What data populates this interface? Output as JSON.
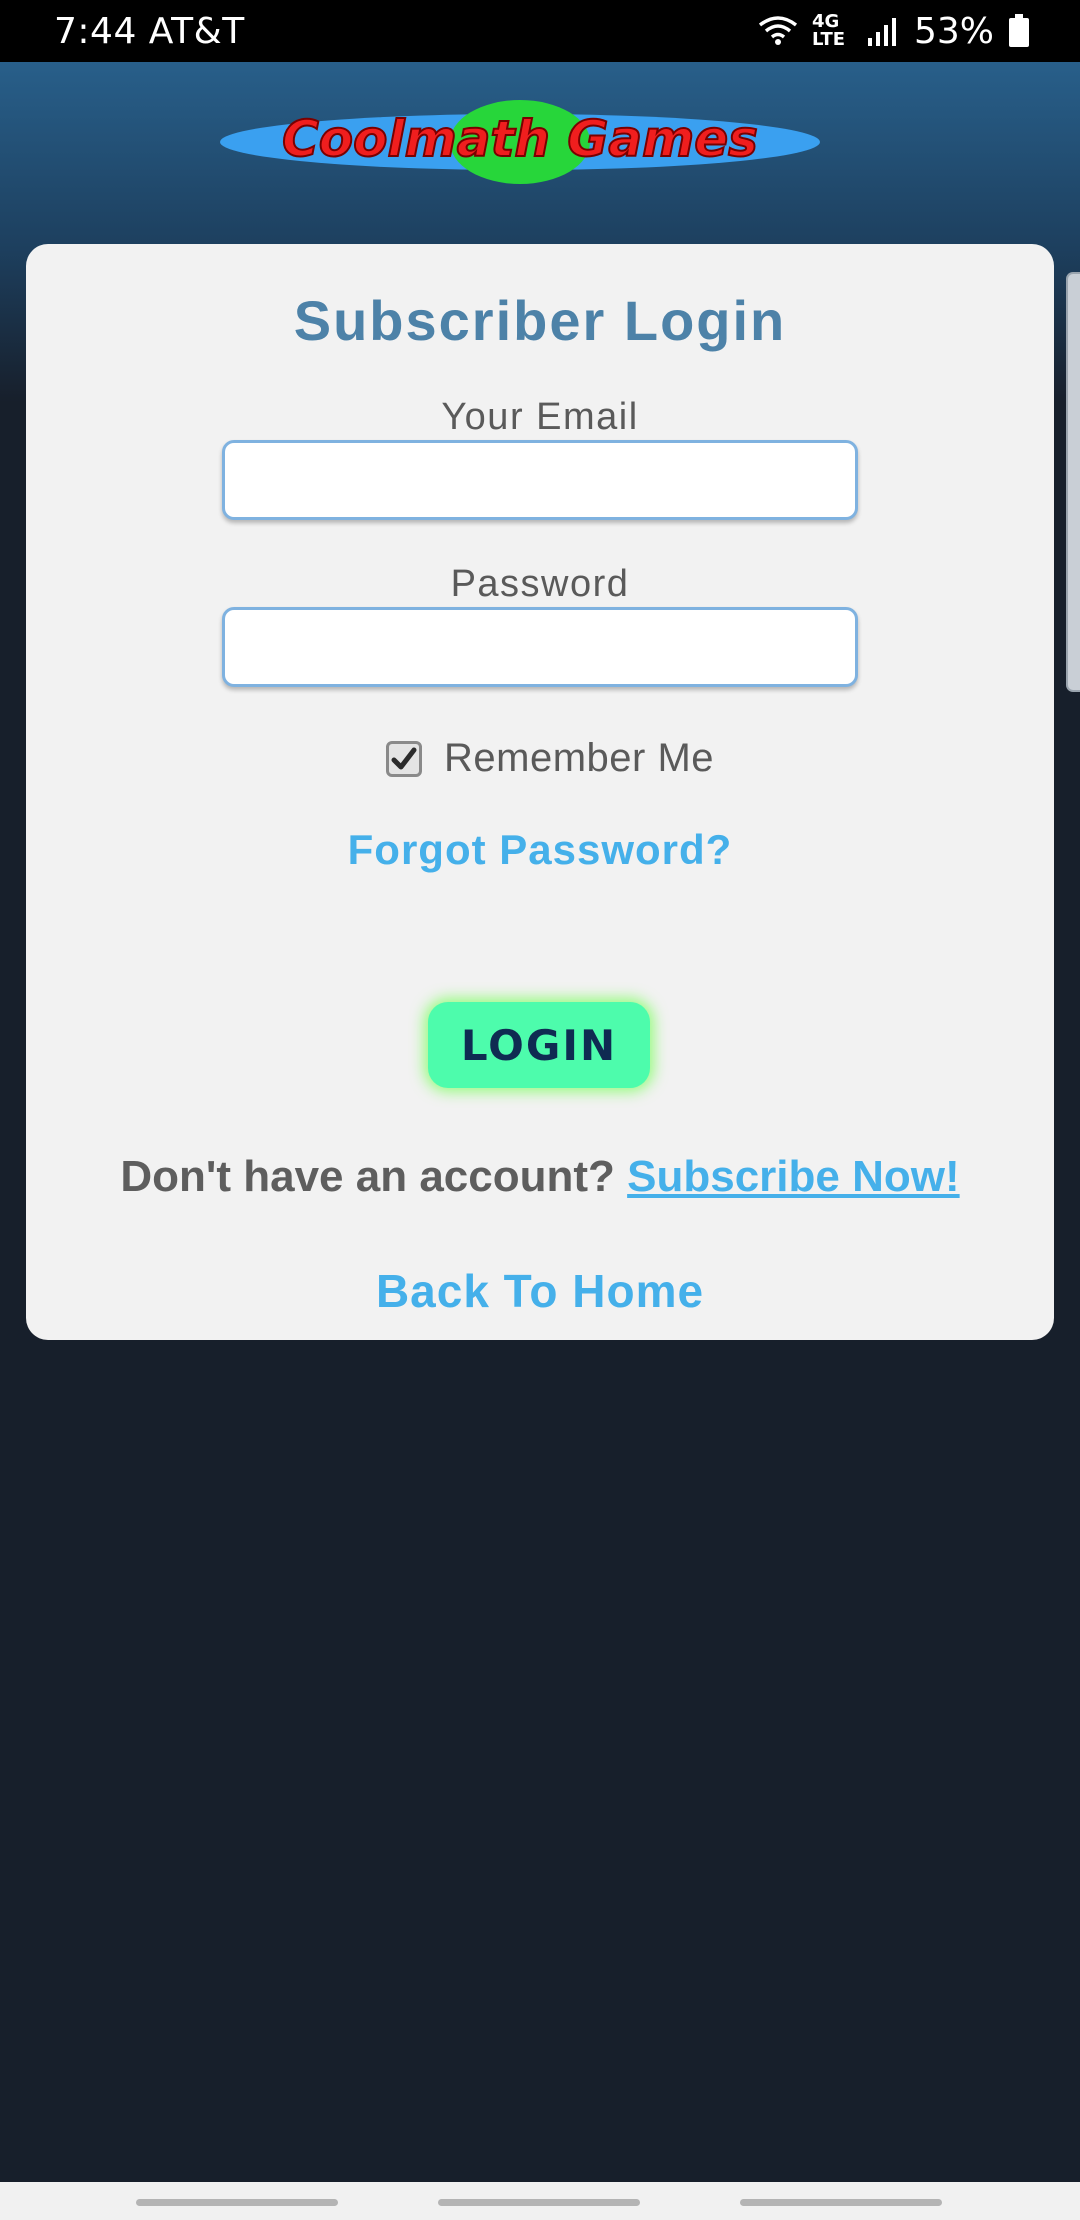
{
  "status_bar": {
    "time": "7:44",
    "carrier": "AT&T",
    "network": "4G LTE",
    "battery": "53%"
  },
  "logo": {
    "text": "Coolmath Games"
  },
  "login_form": {
    "title": "Subscriber Login",
    "email_label": "Your Email",
    "email_value": "",
    "password_label": "Password",
    "password_value": "",
    "remember_label": "Remember Me",
    "remember_checked": true,
    "forgot_password": "Forgot Password?",
    "login_button": "LOGIN",
    "no_account_text": "Don't have an account?",
    "subscribe_link": "Subscribe Now!",
    "back_home": "Back To Home"
  },
  "colors": {
    "accent_blue": "#45b0ea",
    "title_blue": "#4d82a8",
    "login_green": "#4dfcac",
    "page_dark": "#171f2b"
  }
}
